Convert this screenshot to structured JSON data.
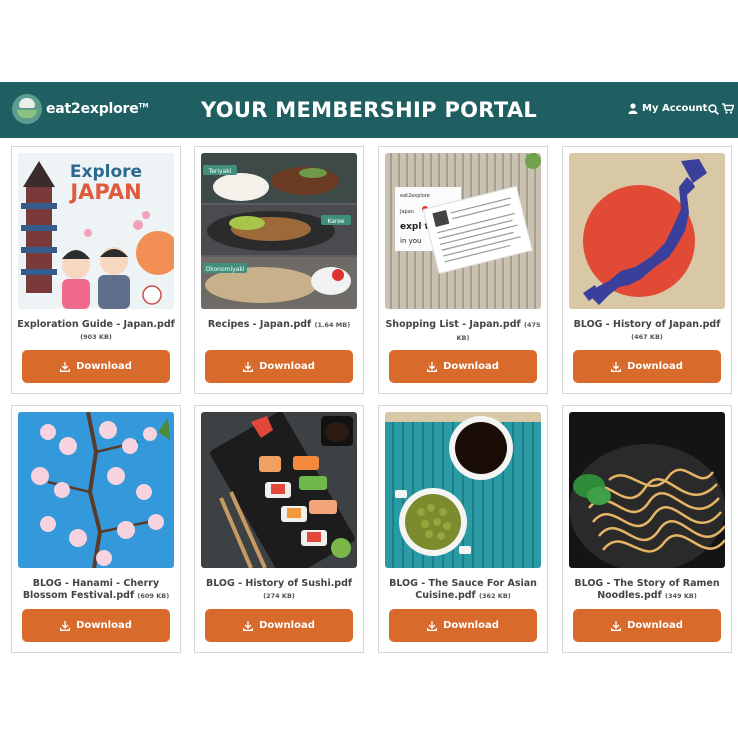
{
  "header": {
    "logo": "eat2explore",
    "logo_tm": "TM",
    "title": "YOUR MEMBERSHIP PORTAL",
    "account_label": "My Account"
  },
  "colors": {
    "header_bg": "#1f5f62",
    "button": "#d86a2c"
  },
  "cards": [
    {
      "title": "Exploration Guide - Japan.pdf",
      "size": "(903 KB)",
      "button": "Download",
      "image": "explore-japan-cover",
      "thumb_text": {
        "line1": "Explore",
        "line2": "JAPAN"
      }
    },
    {
      "title": "Recipes - Japan.pdf",
      "size": "(1.64 MB)",
      "button": "Download",
      "image": "japanese-dishes-collage",
      "thumb_text": {
        "tag1": "Teriyaki",
        "tag2": "Karee",
        "tag3": "Okonomiyaki"
      }
    },
    {
      "title": "Shopping List - Japan.pdf",
      "size": "(475 KB)",
      "button": "Download",
      "image": "shopping-list-cards",
      "thumb_text": {
        "brand": "eat2explore",
        "country": "Japan",
        "big": "expl the",
        "small": "in you"
      }
    },
    {
      "title": "BLOG - History of Japan.pdf",
      "size": "(467 KB)",
      "button": "Download",
      "image": "japan-map-flag"
    },
    {
      "title": "BLOG - Hanami - Cherry Blossom Festival.pdf",
      "size": "(609 KB)",
      "button": "Download",
      "image": "cherry-blossoms"
    },
    {
      "title": "BLOG - History of Sushi.pdf",
      "size": "(274 KB)",
      "button": "Download",
      "image": "sushi-platter"
    },
    {
      "title": "BLOG - The Sauce For Asian Cuisine.pdf",
      "size": "(362 KB)",
      "button": "Download",
      "image": "soy-sauce-bowl"
    },
    {
      "title": "BLOG - The Story of Ramen Noodles.pdf",
      "size": "(349 KB)",
      "button": "Download",
      "image": "ramen-noodles"
    }
  ]
}
